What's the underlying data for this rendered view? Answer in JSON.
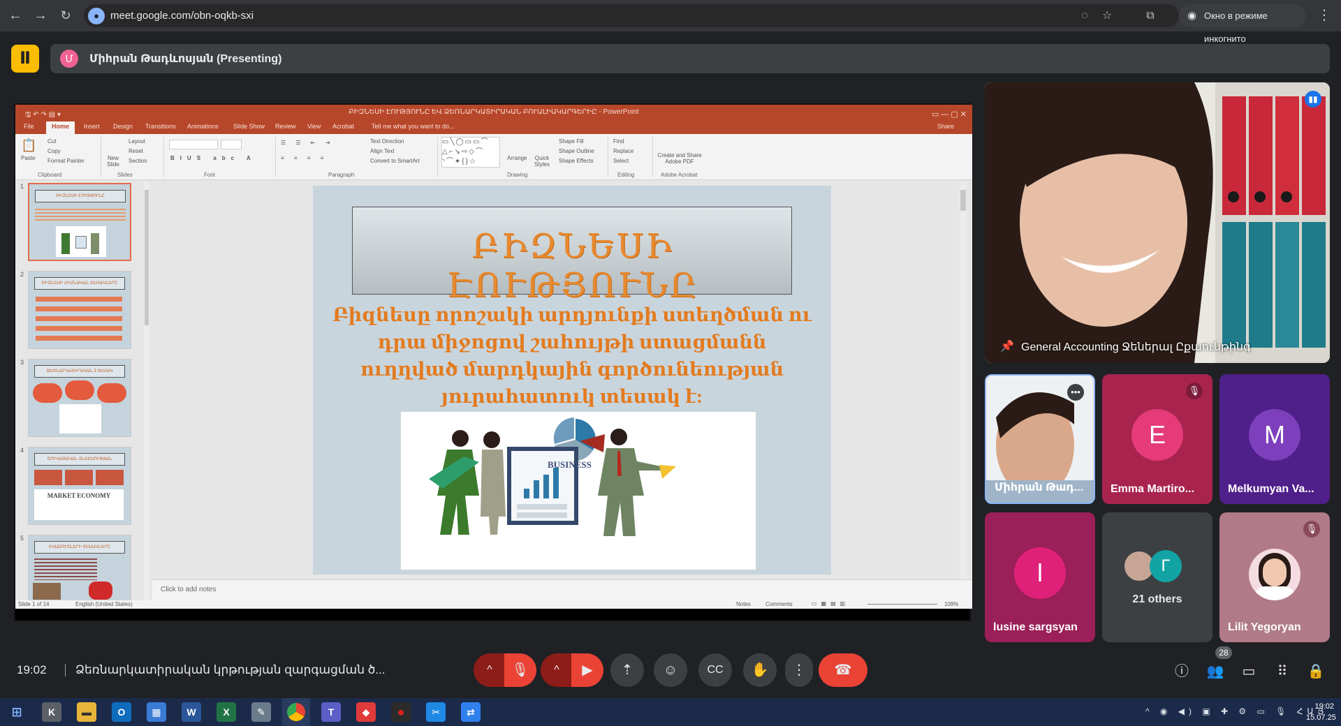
{
  "browser": {
    "url": "meet.google.com/obn-oqkb-sxi",
    "incognito_label": "Окно в режиме инкогнито"
  },
  "meet": {
    "presenter_label": "Միհրան Թադևոսյան (Presenting)",
    "presenter_initial": "Մ"
  },
  "powerpoint": {
    "window_title": "ԲԻԶՆԵՍԻ ԷՈՒԹՅՈՒՆԸ ԵՎ ՁԵՌՆԱՐԿԱՏԻՐԱԿԱՆ ԲՈՒԱԼԻԱԿԱՐԳԵՐԻԸ - PowerPoint",
    "tabs": [
      "File",
      "Home",
      "Insert",
      "Design",
      "Transitions",
      "Animations",
      "Slide Show",
      "Review",
      "View",
      "Acrobat"
    ],
    "tell_me": "Tell me what you want to do...",
    "share": "Share",
    "ribbon": {
      "paste": "Paste",
      "cut": "Cut",
      "copy": "Copy",
      "format_painter": "Format Painter",
      "new_slide": "New Slide",
      "layout": "Layout",
      "reset": "Reset",
      "section": "Section",
      "text_direction": "Text Direction",
      "align_text": "Align Text",
      "convert_smartart": "Convert to SmartArt",
      "arrange": "Arrange",
      "quick_styles": "Quick Styles",
      "shape_fill": "Shape Fill",
      "shape_outline": "Shape Outline",
      "shape_effects": "Shape Effects",
      "find": "Find",
      "replace": "Replace",
      "select": "Select",
      "create_share_pdf": "Create and Share Adobe PDF",
      "groups": [
        "Clipboard",
        "Slides",
        "Font",
        "Paragraph",
        "Drawing",
        "Editing",
        "Adobe Acrobat"
      ]
    },
    "thumbnails": [
      {
        "num": "1",
        "title": "ԲԻԶՆԵՍԻ ԷՈՒԹՅՈՒՆԸ"
      },
      {
        "num": "2",
        "title": "ԲԻԶՆԵՍԻ ՀԻՄՆԱԿԱՆ ՏԵՍԱԿՆԵՐԸ"
      },
      {
        "num": "3",
        "title": "ՁԵՌՆԱՐԿԱՏԻՐԱԿԱՆ 3 ՏԵՍԱԿ"
      },
      {
        "num": "4",
        "title": "ՇՈՒԿԱՅԱԿԱՆ ՏՆՏԵՍՈՒԹՅԱՆ ՀԻՄՆԱԿԱՆ ՏԵՍԱԿ"
      },
      {
        "num": "5",
        "title": "ԵԿԱՄՈՒՏՆԵՐԻ ՏԵՍԱԿՆԵՐԸ"
      }
    ],
    "thumb4_banner": "MARKET ECONOMY",
    "slide": {
      "title": "ԲԻԶՆԵՍԻ ԷՈՒԹՅՈՒՆԸ",
      "body": "Բիզնեսը որոշակի արդյունքի ստեղծման ու դրա միջոցով շահույթի ստացմանն ուղղված մարդկային գործունեության յուրահատուկ տեսակ է:",
      "image_label": "BUSINESS"
    },
    "notes_placeholder": "Click to add notes",
    "status_slide": "Slide 1 of 14",
    "status_lang": "English (United States)",
    "status_notes": "Notes",
    "status_comments": "Comments",
    "zoom": "109%"
  },
  "participants": {
    "main": {
      "name": "General Accounting Ջեներալ Ըքաունթինգ"
    },
    "tiles": [
      {
        "name": "Միհրան Թադ...",
        "type": "video",
        "muted": false
      },
      {
        "name": "Emma Martiro...",
        "initial": "E",
        "color": "#e53b78",
        "bg": "#a8244e",
        "muted": true
      },
      {
        "name": "Melkumyan Va...",
        "initial": "M",
        "color": "#7e3fbd",
        "bg": "#4f1f8a",
        "muted": false
      },
      {
        "name": "lusine sargsyan",
        "initial": "l",
        "color": "#e0217a",
        "bg": "#9b1f58",
        "muted": false
      },
      {
        "name": "21 others",
        "initial": "Г",
        "color": "#12a4a4",
        "bg": "#3c4043",
        "muted": false
      },
      {
        "name": "Lilit Yegoryan",
        "initial": "",
        "color": "#f5dce2",
        "bg": "#b07a88",
        "muted": true
      }
    ]
  },
  "bottom": {
    "time": "19:02",
    "meeting_name": "Ձեռնարկատիրական կրթության զարգացման ծ...",
    "people_count": "28"
  },
  "taskbar": {
    "tray_lang": "ՀԱՅ",
    "clock_time": "19:02",
    "clock_date": "15.07.25"
  }
}
